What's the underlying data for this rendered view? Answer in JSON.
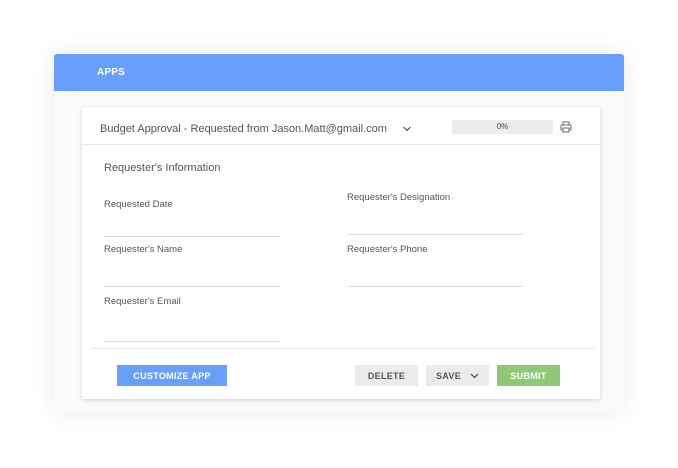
{
  "app": {
    "title": "APPS"
  },
  "record": {
    "title": "Budget Approval - Requested from Jason.Matt@gmail.com",
    "progress_percent": 0,
    "progress_label": "0%"
  },
  "form": {
    "section_title": "Requester's Information",
    "fields": [
      {
        "label": "Requested Date",
        "value": ""
      },
      {
        "label": "Requester's Designation",
        "value": ""
      },
      {
        "label": "Requester's Name",
        "value": ""
      },
      {
        "label": "Requester's Phone",
        "value": ""
      },
      {
        "label": "Requester's Email",
        "value": ""
      }
    ]
  },
  "actions": {
    "customize_label": "CUSTOMIZE APP",
    "delete_label": "DELETE",
    "save_label": "SAVE",
    "submit_label": "SUBMIT"
  },
  "icons": {
    "dropdown": "chevron-down-icon",
    "print": "printer-icon",
    "save_menu": "chevron-down-icon"
  },
  "colors": {
    "accent": "#6a9ff9",
    "submit": "#8fc878",
    "neutral_button": "#ebebeb"
  }
}
